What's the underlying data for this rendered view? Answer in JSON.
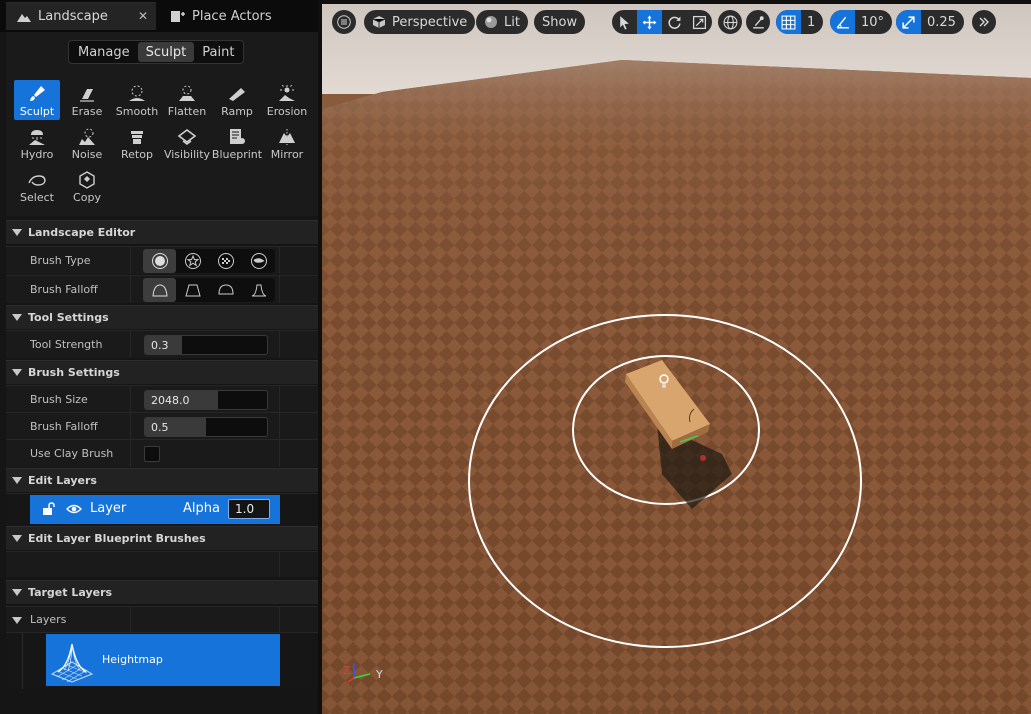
{
  "tabs": [
    {
      "label": "Landscape",
      "icon": "mountain-icon",
      "active": true,
      "closable": true
    },
    {
      "label": "Place Actors",
      "icon": "place-actors-icon",
      "active": false
    }
  ],
  "modes": [
    {
      "label": "Manage",
      "active": false
    },
    {
      "label": "Sculpt",
      "active": true
    },
    {
      "label": "Paint",
      "active": false
    }
  ],
  "tools": [
    {
      "label": "Sculpt",
      "icon": "sculpt-brush-icon",
      "active": true
    },
    {
      "label": "Erase",
      "icon": "erase-icon"
    },
    {
      "label": "Smooth",
      "icon": "smooth-icon"
    },
    {
      "label": "Flatten",
      "icon": "flatten-icon"
    },
    {
      "label": "Ramp",
      "icon": "ramp-icon"
    },
    {
      "label": "Erosion",
      "icon": "erosion-icon"
    },
    {
      "label": "Hydro",
      "icon": "hydro-icon"
    },
    {
      "label": "Noise",
      "icon": "noise-icon"
    },
    {
      "label": "Retop",
      "icon": "retop-icon"
    },
    {
      "label": "Visibility",
      "icon": "visibility-icon"
    },
    {
      "label": "Blueprint",
      "icon": "blueprint-icon"
    },
    {
      "label": "Mirror",
      "icon": "mirror-icon"
    },
    {
      "label": "Select",
      "icon": "select-icon"
    },
    {
      "label": "Copy",
      "icon": "copy-icon"
    }
  ],
  "sections": {
    "landscape_editor": "Landscape Editor",
    "tool_settings": "Tool Settings",
    "brush_settings": "Brush Settings",
    "edit_layers": "Edit Layers",
    "edit_layer_blueprint_brushes": "Edit Layer Blueprint Brushes",
    "target_layers": "Target Layers"
  },
  "props": {
    "brush_type_label": "Brush Type",
    "brush_falloff_type_label": "Brush Falloff",
    "tool_strength_label": "Tool Strength",
    "tool_strength_value": "0.3",
    "brush_size_label": "Brush Size",
    "brush_size_value": "2048.0",
    "brush_falloff_label": "Brush Falloff",
    "brush_falloff_value": "0.5",
    "use_clay_brush_label": "Use Clay Brush",
    "use_clay_brush_checked": false
  },
  "edit_layers": {
    "layer_name": "Layer",
    "alpha_label": "Alpha",
    "alpha_value": "1.0"
  },
  "target_layers": {
    "layers_label": "Layers",
    "heightmap_label": "Heightmap"
  },
  "viewport": {
    "perspective_label": "Perspective",
    "lit_label": "Lit",
    "show_label": "Show",
    "grid_value": "1",
    "angle_value": "10°",
    "scale_value": "0.25",
    "axis_y_label": "Y",
    "axis_z_label": "Z"
  },
  "colors": {
    "accent": "#1673d9",
    "ground_light": "#96633f",
    "ground_dark": "#5e3a23",
    "sky": "#d8d0c8"
  }
}
